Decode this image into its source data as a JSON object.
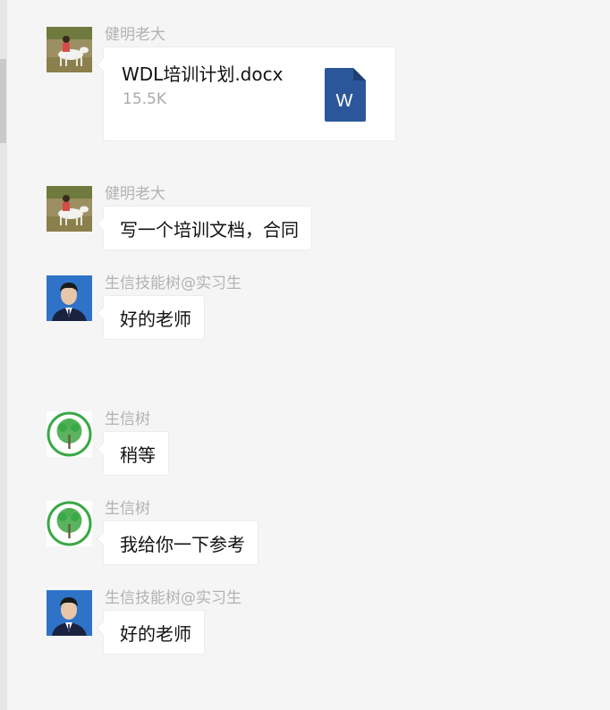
{
  "messages": [
    {
      "sender": "健明老大",
      "avatar": "goat-rider-photo",
      "type": "file",
      "file": {
        "name": "WDL培训计划.docx",
        "size": "15.5K",
        "icon": "word-doc-icon",
        "icon_letter": "W",
        "icon_color": "#2b579a"
      }
    },
    {
      "sender": "健明老大",
      "avatar": "goat-rider-photo",
      "type": "text",
      "text": "写一个培训文档，合同"
    },
    {
      "sender": "生信技能树@实习生",
      "avatar": "portrait-photo",
      "type": "text",
      "text": "好的老师"
    },
    {
      "sender": "生信树",
      "avatar": "tree-logo",
      "type": "text",
      "text": "稍等"
    },
    {
      "sender": "生信树",
      "avatar": "tree-logo",
      "type": "text",
      "text": "我给你一下参考"
    },
    {
      "sender": "生信技能树@实习生",
      "avatar": "portrait-photo",
      "type": "text",
      "text": "好的老师"
    }
  ],
  "colors": {
    "background": "#f5f5f5",
    "bubble": "#ffffff",
    "sender_name": "#b2b2b2",
    "tree_logo_green": "#3aa845"
  }
}
